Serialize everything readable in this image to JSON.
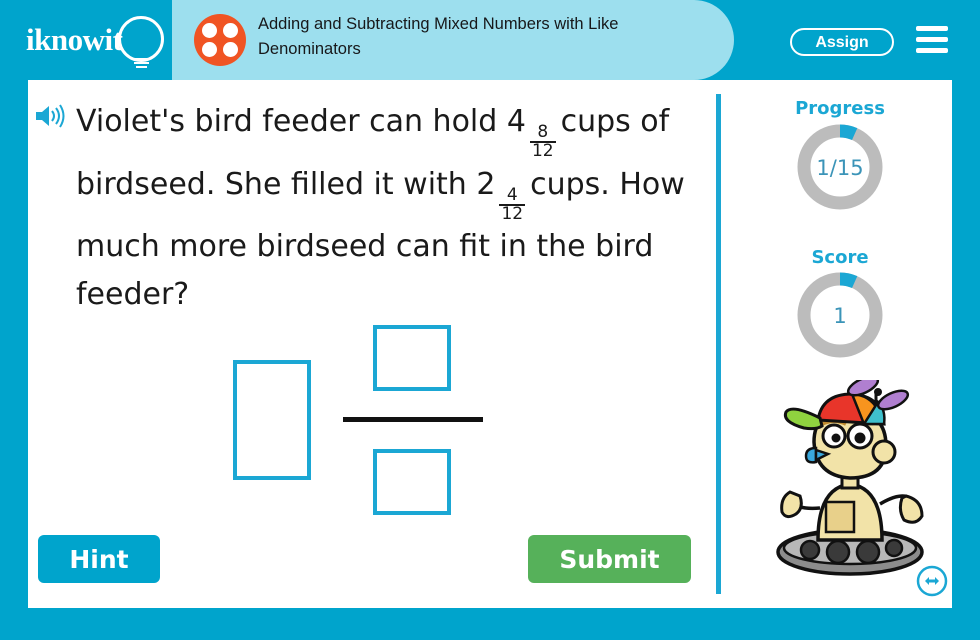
{
  "header": {
    "logo_text": "iknowit",
    "logo_icon": "lightbulb-icon",
    "lesson_icon": "four-dot-dice-icon",
    "lesson_title": "Adding and Subtracting Mixed Numbers with Like Denominators",
    "assign_label": "Assign",
    "menu_icon": "hamburger-menu-icon",
    "colors": {
      "brand_blue": "#00a4cc",
      "title_pill": "#9ddfee",
      "dice_orange": "#f05423"
    }
  },
  "question": {
    "audio_icon": "speaker-icon",
    "line1_prefix": "Violet's bird feeder can hold 4",
    "fraction1": {
      "numerator": "8",
      "denominator": "12"
    },
    "line1_suffix": "cups of birdseed. She filled it with 2",
    "fraction2": {
      "numerator": "4",
      "denominator": "12"
    },
    "line2_suffix": "cups. How much more birdseed can fit in the bird feeder?"
  },
  "answer": {
    "whole_value": "",
    "whole_placeholder": "",
    "numerator_value": "",
    "numerator_placeholder": "",
    "denominator_value": "",
    "denominator_placeholder": "",
    "box_color": "#1ba7d4",
    "bar_color": "#111111"
  },
  "actions": {
    "hint_label": "Hint",
    "hint_color": "#00a4cc",
    "submit_label": "Submit",
    "submit_color": "#56b15a"
  },
  "stats": {
    "progress_label": "Progress",
    "progress_value": "1/15",
    "progress_current": 1,
    "progress_total": 15,
    "score_label": "Score",
    "score_value": "1",
    "score_percent": 7,
    "ring_track_color": "#bcbcbc",
    "ring_fill_color": "#1ba7d4"
  },
  "mascot": {
    "name": "robot-mascot",
    "description": "tan robot with rainbow propeller beanie on tank treads"
  },
  "resize": {
    "icon": "resize-horizontal-icon"
  }
}
